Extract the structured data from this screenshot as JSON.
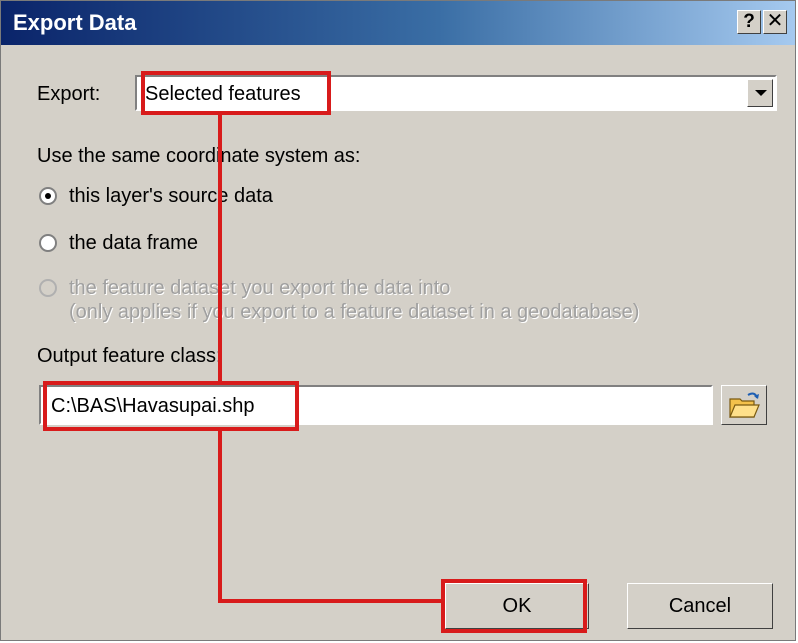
{
  "window": {
    "title": "Export Data"
  },
  "titlebar": {
    "help_label": "?",
    "close_label": "✕"
  },
  "export": {
    "label": "Export:",
    "selected_value": "Selected features"
  },
  "coordinate": {
    "heading": "Use the same coordinate system as:",
    "options": [
      {
        "label": "this layer's source data",
        "checked": true,
        "disabled": false
      },
      {
        "label": "the data frame",
        "checked": false,
        "disabled": false
      },
      {
        "label": "the feature dataset you export the data into",
        "sublabel": "(only applies if you export to a feature dataset in a geodatabase)",
        "checked": false,
        "disabled": true
      }
    ]
  },
  "output": {
    "label": "Output feature class:",
    "value": "C:\\BAS\\Havasupai.shp",
    "browse_icon": "folder-open-icon"
  },
  "buttons": {
    "ok_label": "OK",
    "cancel_label": "Cancel"
  },
  "annotation": {
    "color": "#d81b1b"
  }
}
